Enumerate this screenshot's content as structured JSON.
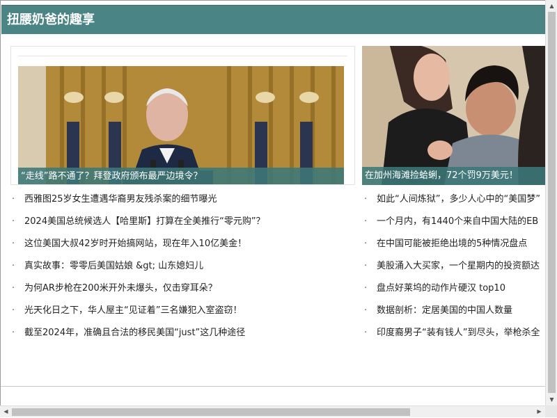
{
  "header": {
    "title": "扭腰奶爸的趣享"
  },
  "featured": [
    {
      "caption": "“走线”路不通了？拜登政府颁布最严边境令？"
    },
    {
      "caption": "在加州海滩捡蛤蜊，72个罚9万美元！"
    }
  ],
  "news_left": [
    "西雅图25岁女生遭遇华裔男友残杀案的细节曝光",
    "2024美国总统候选人【哈里斯】打算在全美推行“零元购”？",
    "这位美国大叔42岁时开始搞网站，现在年入10亿美金！",
    "真实故事：零零后美国姑娘 &gt; 山东媳妇儿",
    "为何AR步枪在200米开外未爆头，仅击穿耳朵？",
    "光天化日之下，华人屋主“见证着”三名嫌犯入室盗窃！",
    "截至2024年，准确且合法的移民美国“just”这几种途径"
  ],
  "news_right": [
    "如此“人间炼狱”，多少人心中的“美国梦”",
    "一个月内，有1440个来自中国大陆的EB",
    "在中国可能被拒绝出境的5种情况盘点",
    "美股涌入大买家，一个星期内的投资额达",
    "盘点好莱坞的动作片硬汉 top10",
    "数据剖析：定居美国的中国人数量",
    "印度裔男子“装有钱人”到尽头，举枪杀全"
  ],
  "bullet": "·",
  "scroll": {
    "up": "▲",
    "down": "▼",
    "left": "◀",
    "right": "▶"
  }
}
